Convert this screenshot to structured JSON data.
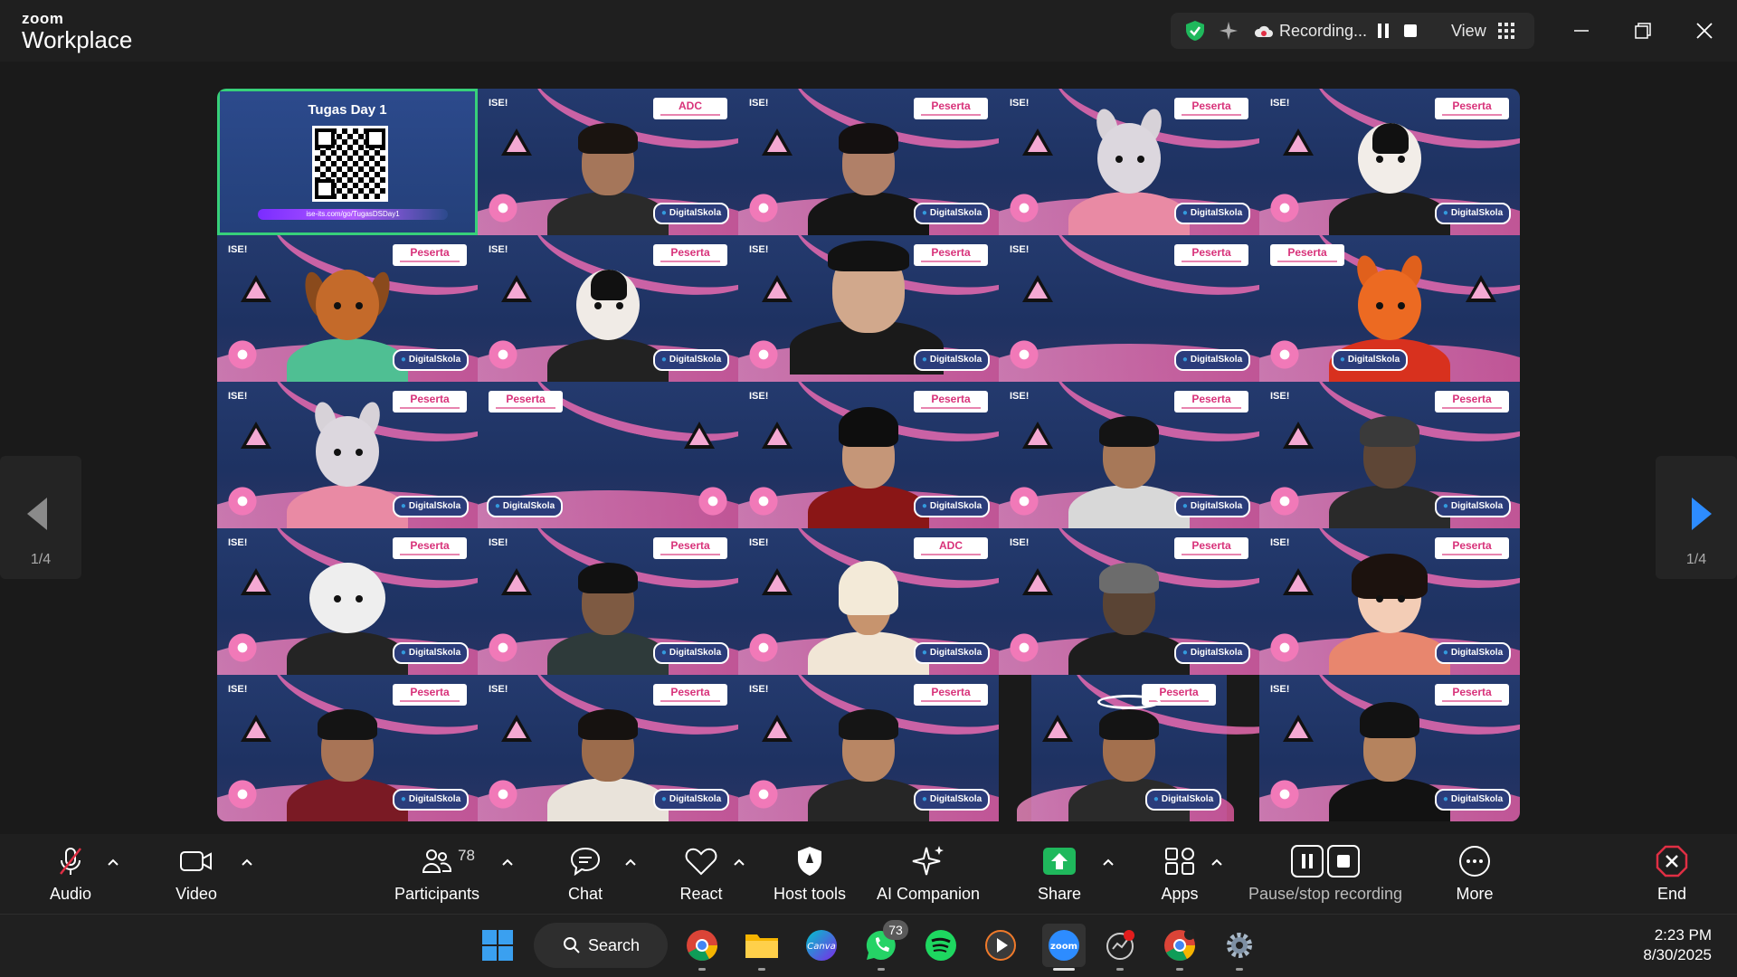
{
  "app": {
    "brand_top": "zoom",
    "brand_bottom": "Workplace"
  },
  "recording": {
    "status": "Recording...",
    "view_label": "View"
  },
  "share": {
    "title": "Tugas Day 1",
    "url": "ise-its.com/go/TugasDSDay1"
  },
  "tile_text": {
    "ise": "ISE!",
    "peserta": "Peserta",
    "adc": "ADC",
    "digital": "DigitalSkola"
  },
  "pager": {
    "left": "1/4",
    "right": "1/4"
  },
  "toolbar": {
    "audio": "Audio",
    "video": "Video",
    "participants": "Participants",
    "participants_count": "78",
    "chat": "Chat",
    "react": "React",
    "host_tools": "Host tools",
    "ai_companion": "AI Companion",
    "share": "Share",
    "apps": "Apps",
    "pause_stop": "Pause/stop recording",
    "more": "More",
    "end": "End"
  },
  "taskbar": {
    "search": "Search",
    "whatsapp_badge": "73",
    "canva": "Canva",
    "zoom": "zoom",
    "time": "2:23 PM",
    "date": "8/30/2025"
  },
  "colors": {
    "accent_green": "#37d07a",
    "end_red": "#e02f44",
    "share_green": "#1fb85c",
    "background": "#1a1a1a"
  }
}
